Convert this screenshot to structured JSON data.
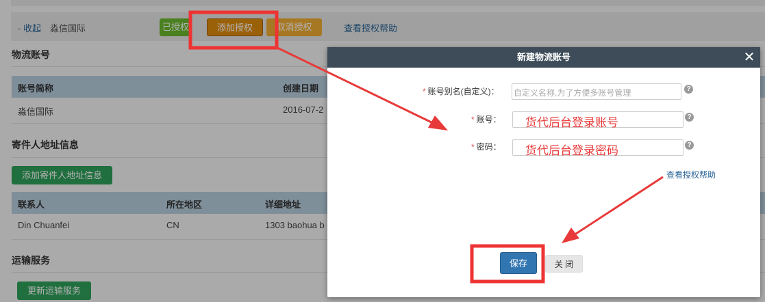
{
  "toolbar": {
    "collapse": "- 收起",
    "company": "淼信国际",
    "authorized": "已授权",
    "add_auth": "添加授权",
    "cancel_auth": "取消授权",
    "help": "查看授权帮助"
  },
  "logistics": {
    "title": "物流账号",
    "headers": [
      "账号简称",
      "创建日期"
    ],
    "rows": [
      [
        "淼信国际",
        "2016-07-2"
      ]
    ]
  },
  "sender": {
    "title": "寄件人地址信息",
    "add_button": "添加寄件人地址信息",
    "headers": [
      "联系人",
      "所在地区",
      "详细地址"
    ],
    "rows": [
      [
        "Din Chuanfei",
        "CN",
        "1303 baohua b"
      ]
    ]
  },
  "transport": {
    "title": "运输服务",
    "update_button": "更新运输服务"
  },
  "modal": {
    "title": "新建物流账号",
    "close_symbol": "✕",
    "alias_label": "账号别名(自定义)：",
    "alias_placeholder": "自定义名称,为了方便多账号管理",
    "account_label": "账号：",
    "account_value": "货代后台登录账号",
    "password_label": "密码：",
    "password_value": "货代后台登录密码",
    "help": "查看授权帮助",
    "save": "保存",
    "close": "关 闭",
    "required_mark": "*",
    "help_icon": "?"
  },
  "annotation_colors": {
    "highlight": "#ee3333",
    "arrow": "#e83a3a"
  }
}
